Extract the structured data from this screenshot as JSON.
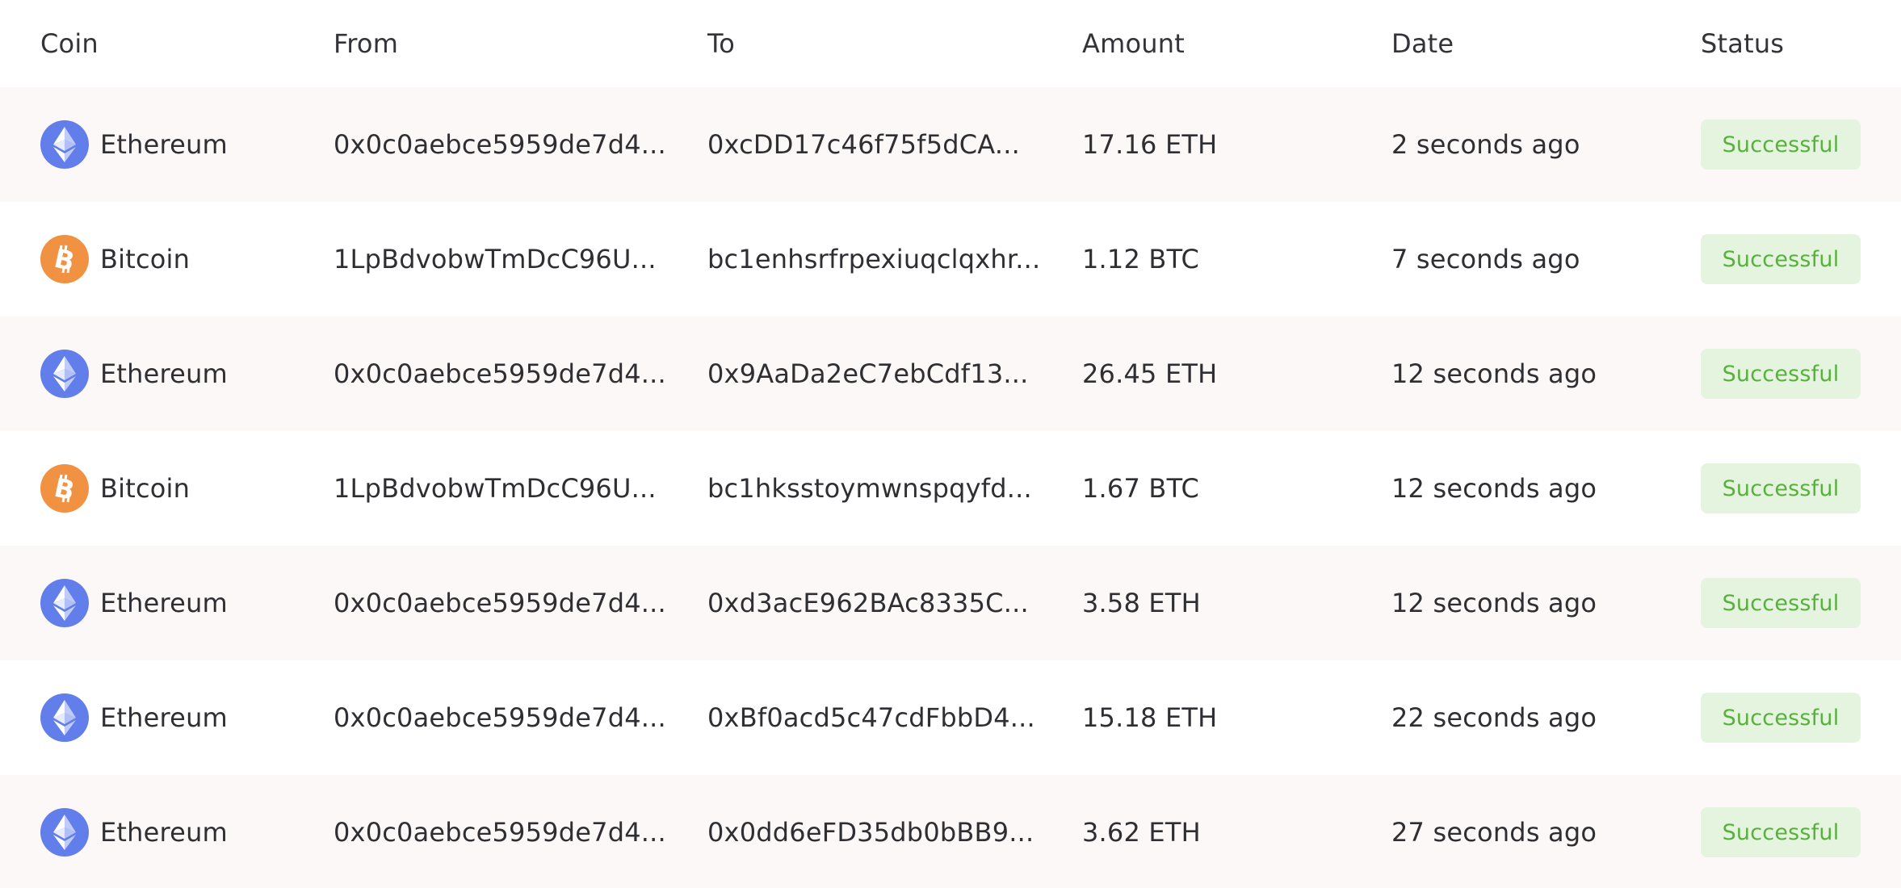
{
  "colors": {
    "row_alt_bg": "#fcf8f7",
    "row_bg": "#ffffff",
    "text": "#2f2f33",
    "ethereum_icon_bg": "#627eea",
    "bitcoin_icon_bg": "#f09242",
    "badge_bg": "#e4f4df",
    "badge_text": "#58b03d"
  },
  "header": {
    "coin": "Coin",
    "from": "From",
    "to": "To",
    "amount": "Amount",
    "date": "Date",
    "status": "Status"
  },
  "rows": [
    {
      "coin": "Ethereum",
      "icon": "ethereum-icon",
      "from": "0x0c0aebce5959de7d4...",
      "to": "0xcDD17c46f75f5dCA...",
      "amount": "17.16 ETH",
      "date": "2 seconds ago",
      "status": "Successful"
    },
    {
      "coin": "Bitcoin",
      "icon": "bitcoin-icon",
      "from": "1LpBdvobwTmDcC96U...",
      "to": "bc1enhsrfrpexiuqclqxhr...",
      "amount": "1.12 BTC",
      "date": "7 seconds ago",
      "status": "Successful"
    },
    {
      "coin": "Ethereum",
      "icon": "ethereum-icon",
      "from": "0x0c0aebce5959de7d4...",
      "to": "0x9AaDa2eC7ebCdf13...",
      "amount": "26.45 ETH",
      "date": "12 seconds ago",
      "status": "Successful"
    },
    {
      "coin": "Bitcoin",
      "icon": "bitcoin-icon",
      "from": "1LpBdvobwTmDcC96U...",
      "to": "bc1hksstoymwnspqyfd...",
      "amount": "1.67 BTC",
      "date": "12 seconds ago",
      "status": "Successful"
    },
    {
      "coin": "Ethereum",
      "icon": "ethereum-icon",
      "from": "0x0c0aebce5959de7d4...",
      "to": "0xd3acE962BAc8335C...",
      "amount": "3.58 ETH",
      "date": "12 seconds ago",
      "status": "Successful"
    },
    {
      "coin": "Ethereum",
      "icon": "ethereum-icon",
      "from": "0x0c0aebce5959de7d4...",
      "to": "0xBf0acd5c47cdFbbD4...",
      "amount": "15.18 ETH",
      "date": "22 seconds ago",
      "status": "Successful"
    },
    {
      "coin": "Ethereum",
      "icon": "ethereum-icon",
      "from": "0x0c0aebce5959de7d4...",
      "to": "0x0dd6eFD35db0bBB9...",
      "amount": "3.62 ETH",
      "date": "27 seconds ago",
      "status": "Successful"
    }
  ]
}
